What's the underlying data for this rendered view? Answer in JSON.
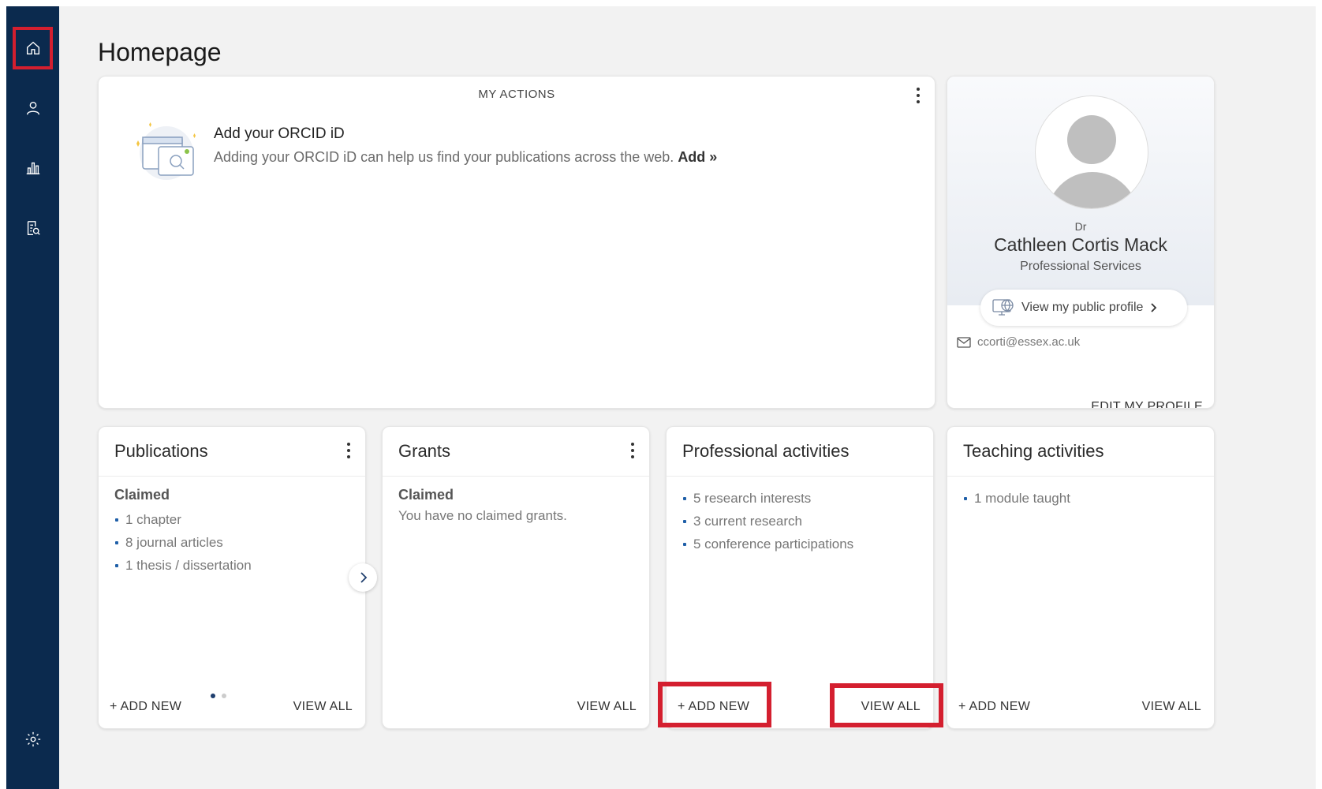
{
  "page": {
    "title": "Homepage"
  },
  "sidebar": {
    "items": [
      {
        "id": "home",
        "icon": "home-icon",
        "active": true
      },
      {
        "id": "profile",
        "icon": "user-icon",
        "active": false
      },
      {
        "id": "reports",
        "icon": "bar-chart-icon",
        "active": false
      },
      {
        "id": "search-docs",
        "icon": "document-search-icon",
        "active": false
      },
      {
        "id": "settings",
        "icon": "gear-icon",
        "active": false
      }
    ]
  },
  "actions": {
    "header": "MY ACTIONS",
    "orcid_title": "Add your ORCID iD",
    "orcid_desc": "Adding your ORCID iD can help us find your publications across the web.",
    "orcid_link": "Add »"
  },
  "profile": {
    "honorific": "Dr",
    "name": "Cathleen Cortis Mack",
    "department": "Professional Services",
    "view_public": "View my public profile",
    "email": "ccorti@essex.ac.uk",
    "edit": "EDIT MY PROFILE"
  },
  "publications": {
    "title": "Publications",
    "subtitle": "Claimed",
    "items": [
      "1 chapter",
      "8 journal articles",
      "1 thesis / dissertation"
    ],
    "add_new": "+ ADD NEW",
    "view_all": "VIEW ALL",
    "carousel_page": 1,
    "carousel_pages": 2
  },
  "grants": {
    "title": "Grants",
    "subtitle": "Claimed",
    "empty": "You have no claimed grants.",
    "view_all": "VIEW ALL"
  },
  "professional": {
    "title": "Professional activities",
    "items": [
      "5 research interests",
      "3 current research",
      "5 conference participations"
    ],
    "add_new": "+ ADD NEW",
    "view_all": "VIEW ALL"
  },
  "teaching": {
    "title": "Teaching activities",
    "items": [
      "1 module taught"
    ],
    "add_new": "+ ADD NEW",
    "view_all": "VIEW ALL"
  },
  "colors": {
    "sidebar": "#0b2a4e",
    "highlight": "#d41f2f",
    "bullet": "#1f5fa8"
  }
}
